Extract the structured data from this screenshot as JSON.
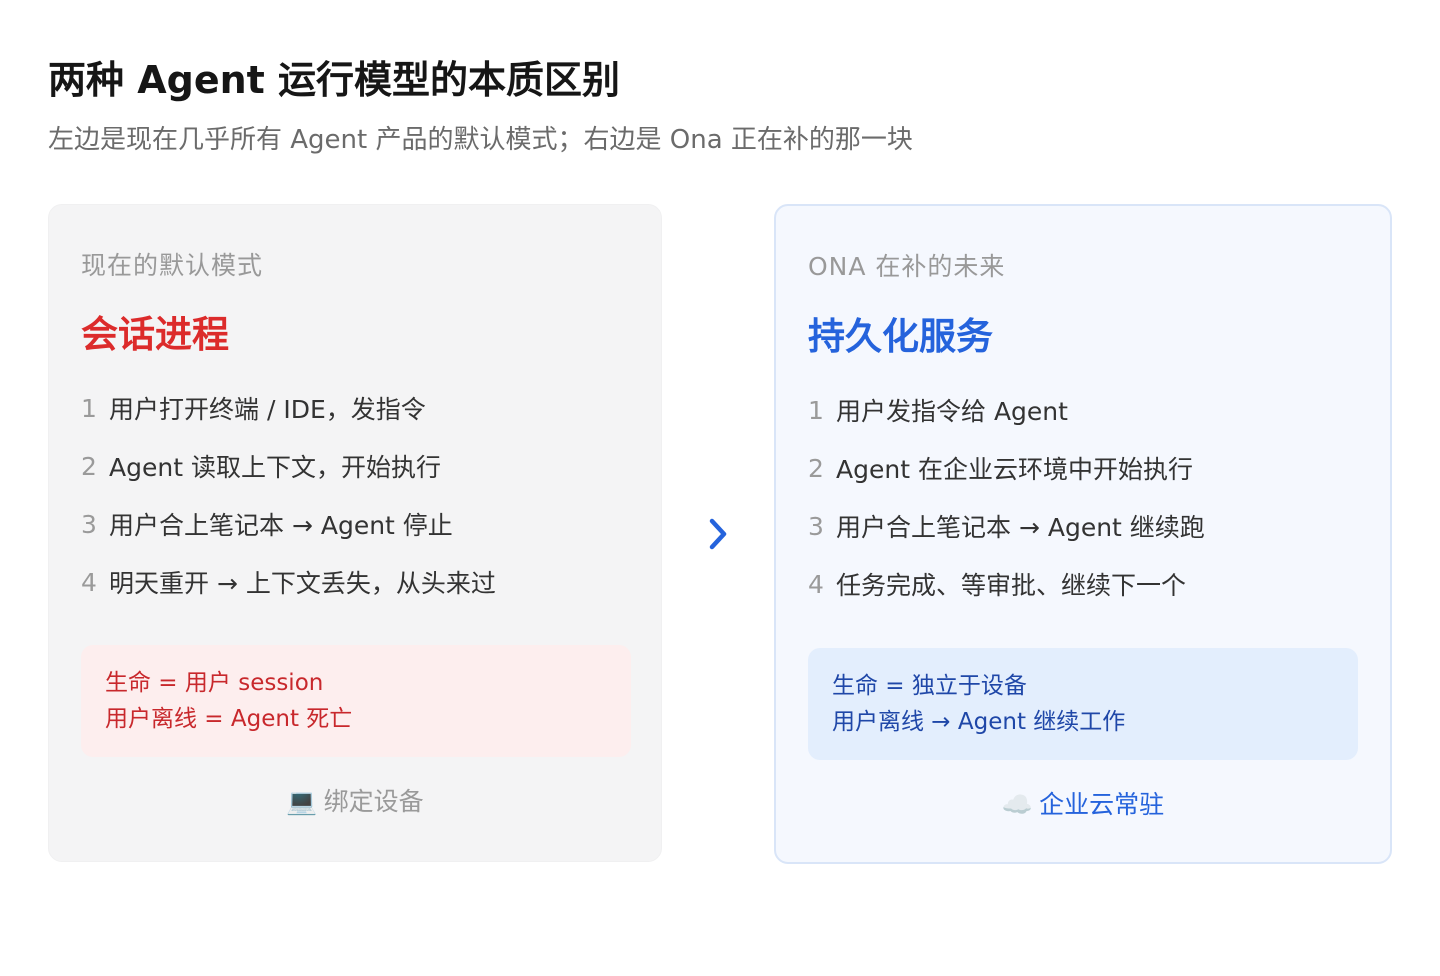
{
  "page": {
    "title": "两种 Agent 运行模型的本质区别",
    "subtitle": "左边是现在几乎所有 Agent 产品的默认模式；右边是 Ona 正在补的那一块"
  },
  "left": {
    "label": "现在的默认模式",
    "heading": "会话进程",
    "steps": [
      {
        "num": "1",
        "text": "用户打开终端 / IDE，发指令"
      },
      {
        "num": "2",
        "text": "Agent 读取上下文，开始执行"
      },
      {
        "num": "3",
        "text": "用户合上笔记本 → Agent 停止"
      },
      {
        "num": "4",
        "text": "明天重开 → 上下文丢失，从头来过"
      }
    ],
    "note": [
      "生命 = 用户 session",
      "用户离线 = Agent 死亡"
    ],
    "footer_icon": "💻",
    "footer_text": "绑定设备"
  },
  "right": {
    "label": "ONA 在补的未来",
    "heading": "持久化服务",
    "steps": [
      {
        "num": "1",
        "text": "用户发指令给 Agent"
      },
      {
        "num": "2",
        "text": "Agent 在企业云环境中开始执行"
      },
      {
        "num": "3",
        "text": "用户合上笔记本 → Agent 继续跑"
      },
      {
        "num": "4",
        "text": "任务完成、等审批、继续下一个"
      }
    ],
    "note": [
      "生命 = 独立于设备",
      "用户离线 → Agent 继续工作"
    ],
    "footer_icon": "☁️",
    "footer_text": "企业云常驻"
  },
  "colors": {
    "left_accent": "#dc2b2b",
    "right_accent": "#2563dc",
    "arrow": "#2563dc"
  },
  "icons": {
    "arrow": "chevron-right-icon",
    "left_footer": "laptop-icon",
    "right_footer": "cloud-icon"
  }
}
